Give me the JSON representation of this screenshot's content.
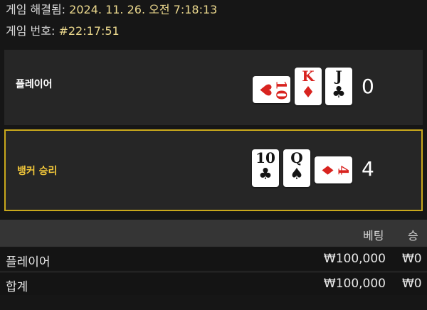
{
  "game": {
    "resolved_label": "게임 해결됨:",
    "resolved_value": "2024. 11. 26. 오전 7:18:13",
    "number_label": "게임 번호:",
    "number_value": "#22:17:51"
  },
  "player": {
    "label": "플레이어",
    "score": "0",
    "cards": [
      {
        "rank": "10",
        "suit": "♥",
        "color": "#d8231f",
        "orientation": "sideways"
      },
      {
        "rank": "K",
        "suit": "♦",
        "color": "#d8231f",
        "orientation": "upright"
      },
      {
        "rank": "J",
        "suit": "♣",
        "color": "#141414",
        "orientation": "upright"
      }
    ]
  },
  "banker": {
    "label": "뱅커 승리",
    "score": "4",
    "cards": [
      {
        "rank": "10",
        "suit": "♣",
        "color": "#141414",
        "orientation": "upright"
      },
      {
        "rank": "Q",
        "suit": "♠",
        "color": "#141414",
        "orientation": "upright"
      },
      {
        "rank": "4",
        "suit": "♦",
        "color": "#d8231f",
        "orientation": "sideways"
      }
    ]
  },
  "bets_table": {
    "headers": {
      "bet": "베팅",
      "win": "승"
    },
    "rows": [
      {
        "name": "플레이어",
        "bet": "₩100,000",
        "win": "₩0"
      }
    ],
    "total": {
      "name": "합계",
      "bet": "₩100,000",
      "win": "₩0"
    }
  },
  "colors": {
    "accent_gold": "#c9a81c",
    "banker_label": "#f2c73a",
    "info_value": "#ecd98e",
    "card_red": "#d8231f"
  }
}
